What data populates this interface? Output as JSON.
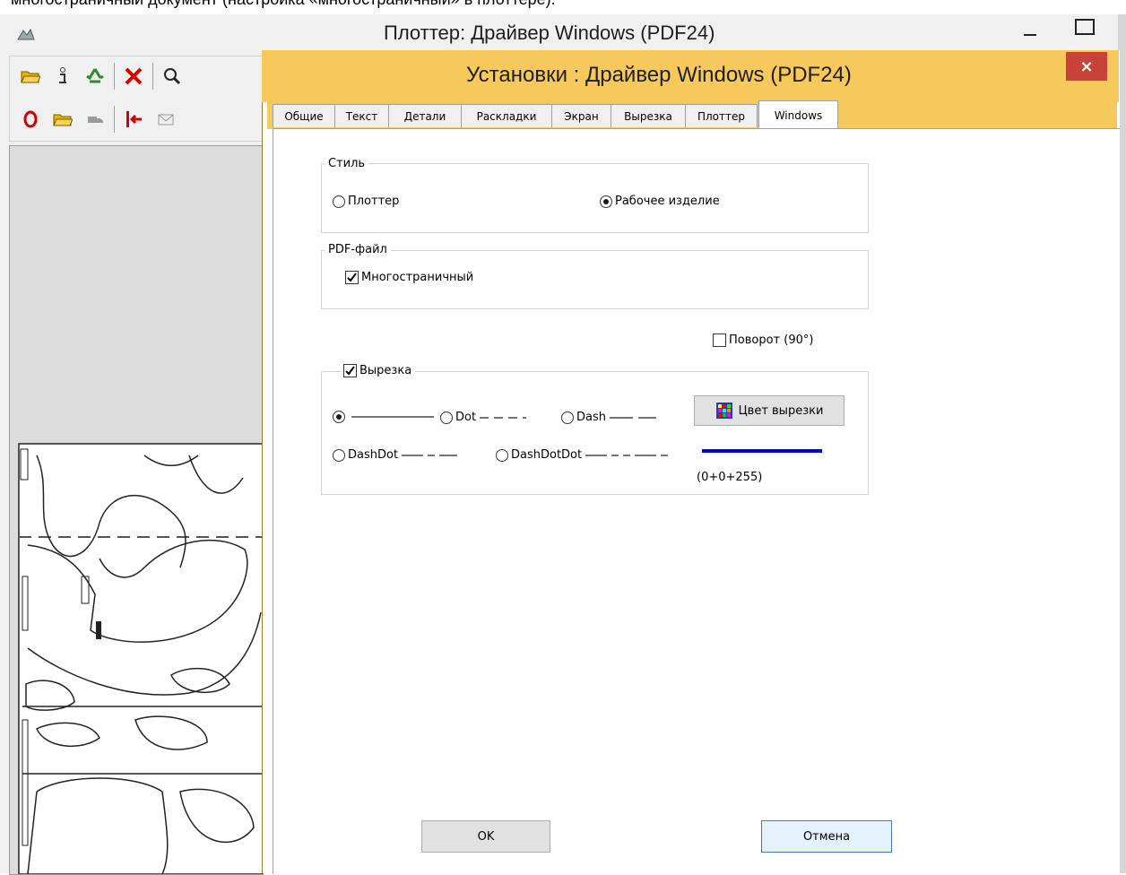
{
  "caption": "многостраничный документ (настройка «многостраничный» в плоттере).",
  "bg_window": {
    "title": "Плоттер: Драйвер Windows (PDF24)",
    "icons": [
      "open-folder-icon",
      "info-icon",
      "recycle-icon",
      "delete-icon",
      "search-icon",
      "stop-icon",
      "open-folder-2-icon",
      "truck-icon",
      "exit-icon",
      "mail-icon"
    ]
  },
  "dialog": {
    "title": "Установки : Драйвер Windows (PDF24)",
    "close": "×",
    "tabs": [
      {
        "label": "Общие"
      },
      {
        "label": "Текст"
      },
      {
        "label": "Детали"
      },
      {
        "label": "Раскладки"
      },
      {
        "label": "Экран"
      },
      {
        "label": "Вырезка"
      },
      {
        "label": "Плоттер"
      },
      {
        "label": "Windows"
      }
    ],
    "active_tab": "Windows",
    "style_group": {
      "legend": "Стиль",
      "options": [
        "Плоттер",
        "Рабочее изделие"
      ],
      "selected": "Рабочее изделие"
    },
    "pdf_group": {
      "legend": "PDF-файл",
      "multipage_label": "Многостраничный",
      "multipage_checked": true
    },
    "rotate_label": "Поворот (90°)",
    "rotate_checked": false,
    "cut_group": {
      "legend": "Вырезка",
      "enabled": true,
      "line_styles": [
        "Dot",
        "Dash",
        "DashDot",
        "DashDotDot"
      ],
      "selected_style": "solid",
      "color_button": "Цвет вырезки",
      "color_value": "(0+0+255)",
      "color_hex": "#0000dd"
    },
    "ok_label": "OK",
    "cancel_label": "Отмена"
  },
  "colors": {
    "dialog_frame": "#f7c95c",
    "close_button": "#c7433a"
  }
}
